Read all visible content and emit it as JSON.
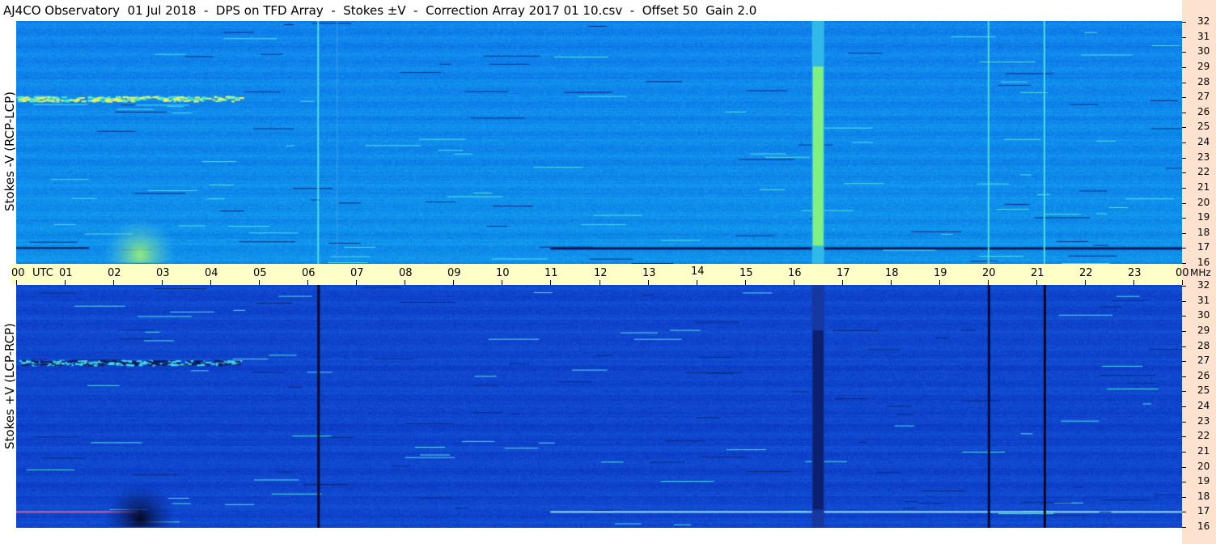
{
  "title": "AJ4CO Observatory  01 Jul 2018  -  DPS on TFD Array  -  Stokes ±V  -  Correction Array 2017 01 10.csv  -  Offset 50  Gain 2.0",
  "colors": {
    "time_axis_bg": "#ffffc8",
    "right_strip_bg": "#fde3cf"
  },
  "chart_data": [
    {
      "type": "heatmap",
      "panel": "top",
      "ylabel": "Stokes -V (RCP-LCP)",
      "y_unit": "MHz",
      "ylim": [
        16,
        32
      ],
      "yticks": [
        "16",
        "17",
        "18",
        "19",
        "20",
        "21",
        "22",
        "23",
        "24",
        "25",
        "26",
        "27",
        "28",
        "29",
        "30",
        "31",
        "32"
      ],
      "x_tick_labels": [
        "00",
        "01",
        "02",
        "03",
        "04",
        "05",
        "06",
        "07",
        "08",
        "09",
        "10",
        "11",
        "12",
        "13",
        "14",
        "15",
        "16",
        "17",
        "18",
        "19",
        "20",
        "21",
        "22",
        "23",
        "00"
      ],
      "x_unit": "UTC",
      "xlim_hours": [
        0,
        24
      ],
      "vertical_features_hours": [
        {
          "t": 6.2,
          "kind": "bright-line"
        },
        {
          "t": 6.6,
          "kind": "faint-line"
        },
        {
          "t": 16.5,
          "kind": "bright-band"
        },
        {
          "t": 20.0,
          "kind": "bright-line"
        },
        {
          "t": 21.15,
          "kind": "bright-line"
        }
      ],
      "horizontal_features_mhz": [
        {
          "f": 17.1,
          "kind": "dark-line"
        },
        {
          "f": 26.9,
          "kind": "bright-streak"
        }
      ]
    },
    {
      "type": "heatmap",
      "panel": "bottom",
      "ylabel": "Stokes +V (LCP-RCP)",
      "y_unit": "MHz",
      "ylim": [
        16,
        32
      ],
      "yticks": [
        "16",
        "17",
        "18",
        "19",
        "20",
        "21",
        "22",
        "23",
        "24",
        "25",
        "26",
        "27",
        "28",
        "29",
        "30",
        "31",
        "32"
      ],
      "x_tick_labels": [
        "00",
        "01",
        "02",
        "03",
        "04",
        "05",
        "06",
        "07",
        "08",
        "09",
        "10",
        "11",
        "12",
        "13",
        "14",
        "15",
        "16",
        "17",
        "18",
        "19",
        "20",
        "21",
        "22",
        "23",
        "00"
      ],
      "x_unit": "UTC",
      "xlim_hours": [
        0,
        24
      ],
      "vertical_features_hours": [
        {
          "t": 6.2,
          "kind": "dark-line"
        },
        {
          "t": 16.5,
          "kind": "dark-band"
        },
        {
          "t": 20.0,
          "kind": "dark-line"
        },
        {
          "t": 21.15,
          "kind": "dark-line"
        }
      ],
      "horizontal_features_mhz": [
        {
          "f": 17.1,
          "kind": "bright-line"
        },
        {
          "f": 26.9,
          "kind": "bright-streak"
        }
      ]
    }
  ],
  "axis": {
    "time_unit_label": "UTC",
    "freq_unit_label": "MHz"
  }
}
